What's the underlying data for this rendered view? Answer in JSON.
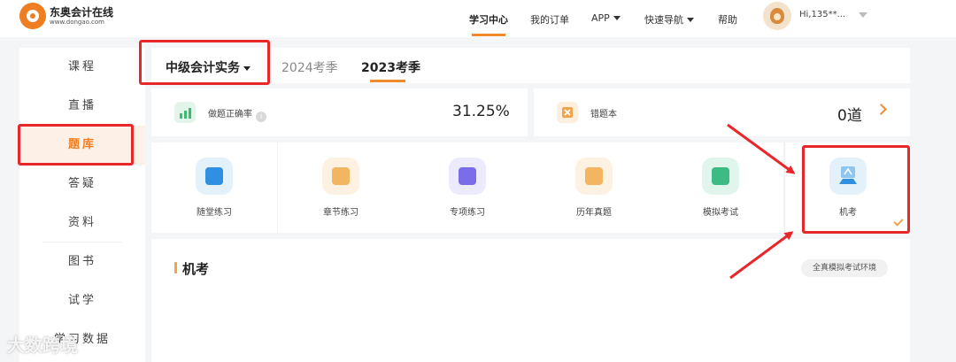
{
  "brand": {
    "name": "东奥会计在线",
    "url": "www.dongao.com"
  },
  "nav": {
    "items": [
      "学习中心",
      "我的订单",
      "APP",
      "快速导航",
      "帮助"
    ],
    "user": "Hi,135**..."
  },
  "sidebar": {
    "items": [
      "课程",
      "直播",
      "题库",
      "答疑",
      "资料",
      "图书",
      "试学",
      "学习数据"
    ]
  },
  "tabs": {
    "subject": "中级会计实务",
    "seasons": [
      "2024考季",
      "2023考季"
    ]
  },
  "stats": {
    "accuracy_label": "做题正确率",
    "accuracy_value": "31.25%",
    "wrongbook_label": "错题本",
    "wrongbook_value": "0道"
  },
  "practice": {
    "items": [
      "随堂练习",
      "章节练习",
      "专项练习",
      "历年真题",
      "模拟考试",
      "机考"
    ]
  },
  "section": {
    "title": "机考",
    "badge": "全真模拟考试环境"
  },
  "watermark": "大数跨境",
  "colors": {
    "accent": "#f08a2c",
    "annotation": "#e8272b"
  }
}
